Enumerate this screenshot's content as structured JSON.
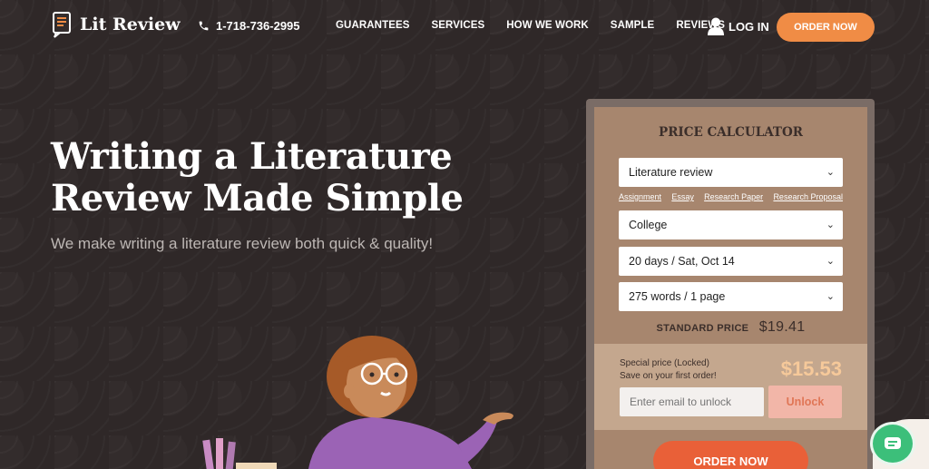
{
  "header": {
    "logo_text": "Lit Review",
    "phone": "1-718-736-2995",
    "nav": [
      "GUARANTEES",
      "SERVICES",
      "HOW WE WORK",
      "SAMPLE",
      "REVIEWS"
    ],
    "login": "LOG IN",
    "order_button": "ORDER NOW"
  },
  "hero": {
    "title_line1": "Writing a Literature",
    "title_line2": "Review Made Simple",
    "subtitle": "We make writing a literature review both quick & quality!"
  },
  "calculator": {
    "title": "PRICE CALCULATOR",
    "paper_type": "Literature review",
    "quick_links": [
      "Assignment",
      "Essay",
      "Research Paper",
      "Research Proposal"
    ],
    "level": "College",
    "deadline": "20 days / Sat, Oct 14",
    "length": "275 words / 1 page",
    "standard_label": "STANDARD PRICE",
    "standard_price": "$19.41",
    "special_line1": "Special price (Locked)",
    "special_line2": "Save on your first order!",
    "special_price": "$15.53",
    "email_placeholder": "Enter email to unlock",
    "unlock_label": "Unlock",
    "order_label": "ORDER NOW"
  },
  "colors": {
    "background": "#2f2828",
    "accent_orange": "#f08c45",
    "calc_bg": "#a7866e",
    "order_red": "#e96038",
    "chat_green": "#3cbf7a"
  }
}
